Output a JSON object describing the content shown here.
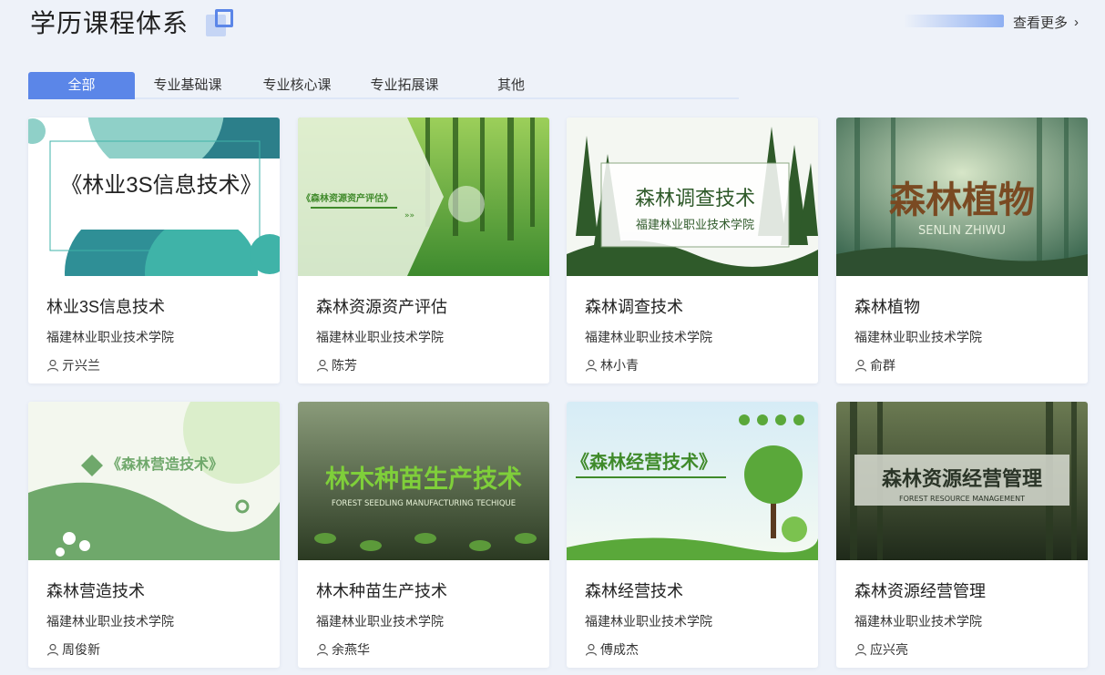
{
  "header": {
    "title": "学历课程体系",
    "more_label": "查看更多",
    "accent_color": "#5b86e8"
  },
  "tabs": [
    {
      "label": "全部",
      "active": true
    },
    {
      "label": "专业基础课",
      "active": false
    },
    {
      "label": "专业核心课",
      "active": false
    },
    {
      "label": "专业拓展课",
      "active": false
    },
    {
      "label": "其他",
      "active": false
    }
  ],
  "courses": [
    {
      "title": "林业3S信息技术",
      "school": "福建林业职业技术学院",
      "teacher": "亓兴兰",
      "cover_text": "《林业3S信息技术》"
    },
    {
      "title": "森林资源资产评估",
      "school": "福建林业职业技术学院",
      "teacher": "陈芳",
      "cover_text": "《森林资源资产评估》"
    },
    {
      "title": "森林调查技术",
      "school": "福建林业职业技术学院",
      "teacher": "林小青",
      "cover_text": "森林调查技术",
      "cover_subtext": "福建林业职业技术学院"
    },
    {
      "title": "森林植物",
      "school": "福建林业职业技术学院",
      "teacher": "俞群",
      "cover_text": "森林植物",
      "cover_subtext": "SENLIN ZHIWU"
    },
    {
      "title": "森林营造技术",
      "school": "福建林业职业技术学院",
      "teacher": "周俊新",
      "cover_text": "《森林营造技术》"
    },
    {
      "title": "林木种苗生产技术",
      "school": "福建林业职业技术学院",
      "teacher": "余燕华",
      "cover_text": "林木种苗生产技术",
      "cover_subtext": "FOREST SEEDLING MANUFACTURING TECHIQUE"
    },
    {
      "title": "森林经营技术",
      "school": "福建林业职业技术学院",
      "teacher": "傅成杰",
      "cover_text": "《森林经营技术》"
    },
    {
      "title": "森林资源经营管理",
      "school": "福建林业职业技术学院",
      "teacher": "应兴亮",
      "cover_text": "森林资源经营管理",
      "cover_subtext": "FOREST RESOURCE MANAGEMENT"
    }
  ]
}
